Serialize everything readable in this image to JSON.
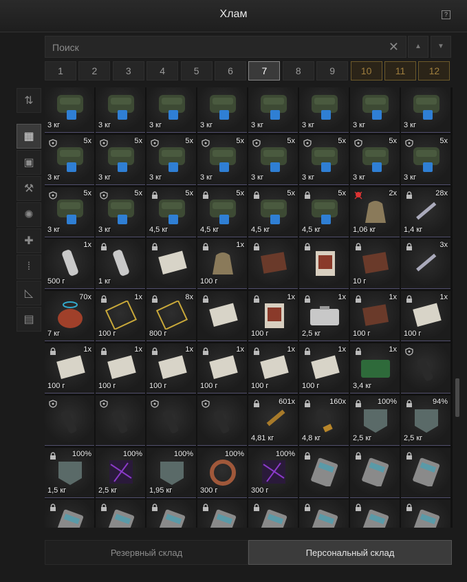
{
  "window": {
    "title": "Хлам",
    "help_label": "?"
  },
  "search": {
    "placeholder": "Поиск",
    "clear_label": "✕",
    "up_label": "▲",
    "down_label": "▼"
  },
  "pages": [
    {
      "label": "1"
    },
    {
      "label": "2"
    },
    {
      "label": "3"
    },
    {
      "label": "4"
    },
    {
      "label": "5"
    },
    {
      "label": "6"
    },
    {
      "label": "7",
      "active": true
    },
    {
      "label": "8"
    },
    {
      "label": "9"
    },
    {
      "label": "10",
      "premium": true
    },
    {
      "label": "11",
      "premium": true
    },
    {
      "label": "12",
      "premium": true
    }
  ],
  "sidebar": [
    {
      "icon": "sort-icon",
      "glyph": "⇅"
    },
    {
      "icon": "grid-icon",
      "glyph": "▦",
      "active": true
    },
    {
      "icon": "armor-icon",
      "glyph": "▣"
    },
    {
      "icon": "weapon-icon",
      "glyph": "⚒"
    },
    {
      "icon": "artifact-icon",
      "glyph": "✺"
    },
    {
      "icon": "medkit-icon",
      "glyph": "✚"
    },
    {
      "icon": "ammo-icon",
      "glyph": "⁞"
    },
    {
      "icon": "tools-icon",
      "glyph": "◺"
    },
    {
      "icon": "storage-box-icon",
      "glyph": "▤"
    }
  ],
  "grid_rows": [
    [
      {
        "w": "3 кг",
        "art": "backpack"
      },
      {
        "w": "3 кг",
        "art": "backpack"
      },
      {
        "w": "3 кг",
        "art": "backpack"
      },
      {
        "w": "3 кг",
        "art": "backpack"
      },
      {
        "w": "3 кг",
        "art": "backpack"
      },
      {
        "w": "3 кг",
        "art": "backpack"
      },
      {
        "w": "3 кг",
        "art": "backpack"
      },
      {
        "w": "3 кг",
        "art": "backpack"
      }
    ],
    [
      {
        "w": "3 кг",
        "c": "5x",
        "art": "backpack",
        "ic": "shield"
      },
      {
        "w": "3 кг",
        "c": "5x",
        "art": "backpack",
        "ic": "shield"
      },
      {
        "w": "3 кг",
        "c": "5x",
        "art": "backpack",
        "ic": "shield"
      },
      {
        "w": "3 кг",
        "c": "5x",
        "art": "backpack",
        "ic": "shield"
      },
      {
        "w": "3 кг",
        "c": "5x",
        "art": "backpack",
        "ic": "shield"
      },
      {
        "w": "3 кг",
        "c": "5x",
        "art": "backpack",
        "ic": "shield"
      },
      {
        "w": "3 кг",
        "c": "5x",
        "art": "backpack",
        "ic": "shield"
      },
      {
        "w": "3 кг",
        "c": "5x",
        "art": "backpack",
        "ic": "shield"
      }
    ],
    [
      {
        "w": "3 кг",
        "c": "5x",
        "art": "backpack",
        "ic": "shield"
      },
      {
        "w": "3 кг",
        "c": "5x",
        "art": "backpack",
        "ic": "shield"
      },
      {
        "w": "4,5 кг",
        "c": "5x",
        "art": "backpack",
        "ic": "lock"
      },
      {
        "w": "4,5 кг",
        "c": "5x",
        "art": "backpack",
        "ic": "lock"
      },
      {
        "w": "4,5 кг",
        "c": "5x",
        "art": "backpack",
        "ic": "lock"
      },
      {
        "w": "4,5 кг",
        "c": "5x",
        "art": "backpack",
        "ic": "lock"
      },
      {
        "w": "1,06 кг",
        "c": "2x",
        "art": "sack",
        "ic": "skull"
      },
      {
        "w": "1,4 кг",
        "c": "28x",
        "art": "syringe",
        "ic": "lock"
      }
    ],
    [
      {
        "w": "500 г",
        "c": "1x",
        "art": "bottle"
      },
      {
        "w": "1 кг",
        "art": "bottle",
        "ic": "lock"
      },
      {
        "w": "",
        "art": "paper",
        "ic": "lock"
      },
      {
        "w": "100 г",
        "c": "1x",
        "art": "sack",
        "ic": "lock"
      },
      {
        "w": "",
        "art": "book",
        "ic": "lock"
      },
      {
        "w": "",
        "art": "card",
        "ic": "lock"
      },
      {
        "w": "10 г",
        "art": "book",
        "ic": "lock"
      },
      {
        "w": "",
        "c": "3x",
        "art": "syringe",
        "ic": "lock"
      }
    ],
    [
      {
        "w": "7 кг",
        "c": "70x",
        "art": "canister"
      },
      {
        "w": "100 г",
        "c": "1x",
        "art": "frame",
        "ic": "lock"
      },
      {
        "w": "800 г",
        "c": "8x",
        "art": "frame",
        "ic": "lock"
      },
      {
        "w": "",
        "art": "paper",
        "ic": "lock"
      },
      {
        "w": "100 г",
        "c": "1x",
        "art": "card",
        "ic": "lock"
      },
      {
        "w": "2,5 кг",
        "c": "1x",
        "art": "case",
        "ic": "lock"
      },
      {
        "w": "100 г",
        "c": "1x",
        "art": "book",
        "ic": "lock"
      },
      {
        "w": "100 г",
        "c": "1x",
        "art": "paper",
        "ic": "lock"
      }
    ],
    [
      {
        "w": "100 г",
        "c": "1x",
        "art": "paper",
        "ic": "lock"
      },
      {
        "w": "100 г",
        "c": "1x",
        "art": "paper",
        "ic": "lock"
      },
      {
        "w": "100 г",
        "c": "1x",
        "art": "paper",
        "ic": "lock"
      },
      {
        "w": "100 г",
        "c": "1x",
        "art": "paper",
        "ic": "lock"
      },
      {
        "w": "100 г",
        "c": "1x",
        "art": "paper",
        "ic": "lock"
      },
      {
        "w": "100 г",
        "c": "1x",
        "art": "paper",
        "ic": "lock"
      },
      {
        "w": "3,4 кг",
        "c": "1x",
        "art": "crate",
        "ic": "lock"
      },
      {
        "w": "",
        "art": "grip",
        "ic": "shield"
      }
    ],
    [
      {
        "w": "",
        "art": "grip",
        "ic": "shield"
      },
      {
        "w": "",
        "art": "grip",
        "ic": "shield"
      },
      {
        "w": "",
        "art": "grip",
        "ic": "shield"
      },
      {
        "w": "",
        "art": "grip",
        "ic": "shield"
      },
      {
        "w": "4,81 кг",
        "c": "601x",
        "art": "ammo",
        "ic": "lock"
      },
      {
        "w": "4,8 кг",
        "c": "160x",
        "art": "shell",
        "ic": "lock"
      },
      {
        "w": "2,5 кг",
        "c": "100%",
        "art": "plate",
        "ic": "lock"
      },
      {
        "w": "2,5 кг",
        "c": "94%",
        "art": "plate",
        "ic": "lock"
      }
    ],
    [
      {
        "w": "1,5 кг",
        "c": "100%",
        "art": "plate",
        "ic": "lock"
      },
      {
        "w": "2,5 кг",
        "c": "100%",
        "art": "crystal"
      },
      {
        "w": "1,95 кг",
        "c": "100%",
        "art": "plate"
      },
      {
        "w": "300 г",
        "c": "100%",
        "art": "coil"
      },
      {
        "w": "300 г",
        "c": "100%",
        "art": "crystal"
      },
      {
        "w": "",
        "art": "device",
        "ic": "lock"
      },
      {
        "w": "",
        "art": "device",
        "ic": "lock"
      },
      {
        "w": "",
        "art": "device",
        "ic": "lock"
      }
    ],
    [
      {
        "w": "",
        "art": "device",
        "ic": "lock"
      },
      {
        "w": "",
        "art": "device",
        "ic": "lock"
      },
      {
        "w": "",
        "art": "device",
        "ic": "lock"
      },
      {
        "w": "",
        "art": "device",
        "ic": "lock"
      },
      {
        "w": "",
        "art": "device",
        "ic": "lock"
      },
      {
        "w": "",
        "art": "device",
        "ic": "lock"
      },
      {
        "w": "",
        "art": "device",
        "ic": "lock"
      },
      {
        "w": "",
        "art": "device",
        "ic": "lock"
      }
    ]
  ],
  "tabs": {
    "reserve": "Резервный склад",
    "personal": "Персональный склад"
  },
  "colors": {
    "premium_gold": "#a07f3e",
    "row_divider": "#52506e"
  }
}
